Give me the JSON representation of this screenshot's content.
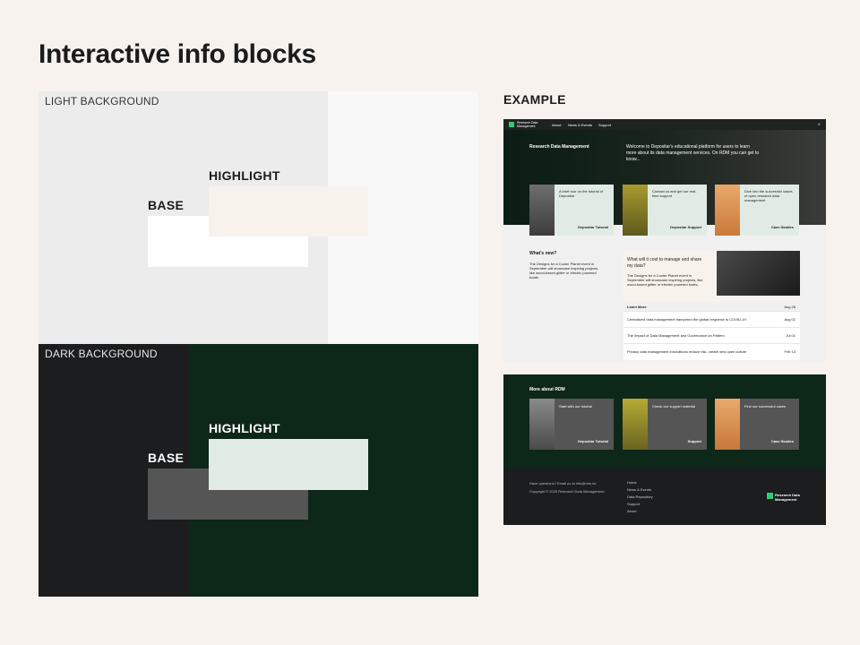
{
  "page": {
    "title": "Interactive info blocks"
  },
  "light": {
    "label": "LIGHT BACKGROUND",
    "base_label": "BASE",
    "highlight_label": "HIGHLIGHT",
    "colors": {
      "panel_left": "#ececec",
      "panel_right": "#f8f8f8",
      "base": "#ffffff",
      "highlight": "#f8f2ec"
    }
  },
  "dark": {
    "label": "DARK BACKGROUND",
    "base_label": "BASE",
    "highlight_label": "HIGHLIGHT",
    "colors": {
      "panel_left": "#1b1d1f",
      "panel_right": "#0d2718",
      "base": "#555555",
      "highlight": "#e1ebe6"
    }
  },
  "example": {
    "label": "EXAMPLE",
    "nav": {
      "brand": "Research Data Management",
      "items": [
        "About",
        "News & Events",
        "Support"
      ]
    },
    "hero": {
      "heading": "Research Data Management",
      "intro": "Welcome to Depositar's educational platform for users to learn more about its data management services. On RDM you can get to know..."
    },
    "cards": [
      {
        "text": "A brief tour on the tutorial of Depositar",
        "link": "Depositar Tutorial"
      },
      {
        "text": "Contact us and get our real-time support",
        "link": "Depositar Support"
      },
      {
        "text": "Dive into the successful cases of open research data management",
        "link": "Case Studies"
      }
    ],
    "news": {
      "heading": "What's new?",
      "text": "The Designs for a Cooler Planet event in September will showcase inspiring projects, like wood-based glitter or electric powered boats.",
      "featured_title": "What will it cost to manage and share my data?",
      "featured_text": "The Designs for a Cooler Planet event in September will showcase inspiring projects, like wood-based glitter or electric powered boats.",
      "learn_more": "Learn More",
      "featured_date": "Aug 28",
      "items": [
        {
          "title": "Centralized data management hampered the global response to COVID-19",
          "date": "Aug 02"
        },
        {
          "title": "The Impact of Data Management and Governance on Pattern",
          "date": "Jul 01"
        },
        {
          "title": "Privacy data management innovations reduce risk, create new open culture",
          "date": "Feb 13"
        }
      ]
    },
    "more": {
      "heading": "More about RDM",
      "cards": [
        {
          "text": "Start with our tutorial",
          "link": "Depositar Tutorial"
        },
        {
          "text": "Check our support material",
          "link": "Support"
        },
        {
          "text": "Find our successful cases",
          "link": "Case Studies"
        }
      ]
    },
    "footer": {
      "contact": "Have questions? Email us at info@rdm.tw",
      "copyright": "Copyright © 2020 Research Data Management",
      "links": [
        "Home",
        "News & Events",
        "Data Repository",
        "Support",
        "About"
      ],
      "brand": "Research Data Management"
    },
    "colors": {
      "dark_green": "#0d2718",
      "accent_green": "#2ecc71"
    }
  }
}
